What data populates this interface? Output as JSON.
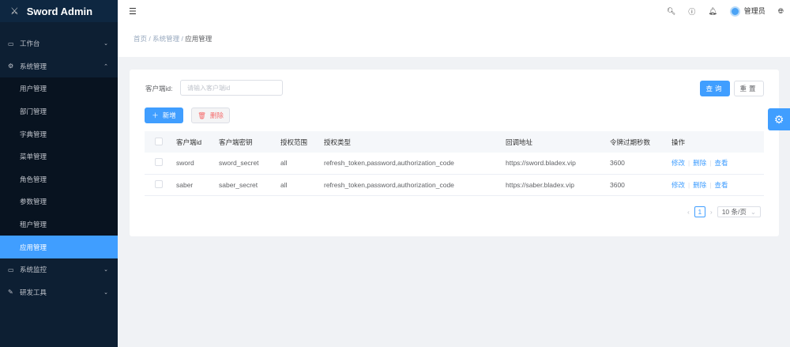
{
  "app": {
    "title": "Sword Admin"
  },
  "sidebar": {
    "items": [
      {
        "label": "工作台",
        "icon": "monitor-icon"
      },
      {
        "label": "系统管理",
        "icon": "gear-icon",
        "expanded": true,
        "children": [
          "用户管理",
          "部门管理",
          "字典管理",
          "菜单管理",
          "角色管理",
          "参数管理",
          "租户管理",
          "应用管理"
        ]
      },
      {
        "label": "系统监控",
        "icon": "monitor-icon"
      },
      {
        "label": "研发工具",
        "icon": "tool-icon"
      }
    ],
    "active": "应用管理"
  },
  "header": {
    "user": "管理员"
  },
  "breadcrumb": [
    "首页",
    "系统管理",
    "应用管理"
  ],
  "search": {
    "label": "客户端id:",
    "placeholder": "请输入客户端id",
    "query": "查询",
    "reset": "重置"
  },
  "toolbar": {
    "add": "新增",
    "delete": "删除"
  },
  "table": {
    "headers": [
      "客户端id",
      "客户端密钥",
      "授权范围",
      "授权类型",
      "回调地址",
      "令牌过期秒数",
      "操作"
    ],
    "rows": [
      [
        "sword",
        "sword_secret",
        "all",
        "refresh_token,password,authorization_code",
        "https://sword.bladex.vip",
        "3600"
      ],
      [
        "saber",
        "saber_secret",
        "all",
        "refresh_token,password,authorization_code",
        "https://saber.bladex.vip",
        "3600"
      ]
    ],
    "actions": [
      "修改",
      "删除",
      "查看"
    ]
  },
  "pagination": {
    "page": "1",
    "size": "10 条/页"
  },
  "colors": {
    "primary": "#409eff",
    "sidebar": "#0d1f33",
    "danger": "#f56c6c"
  }
}
